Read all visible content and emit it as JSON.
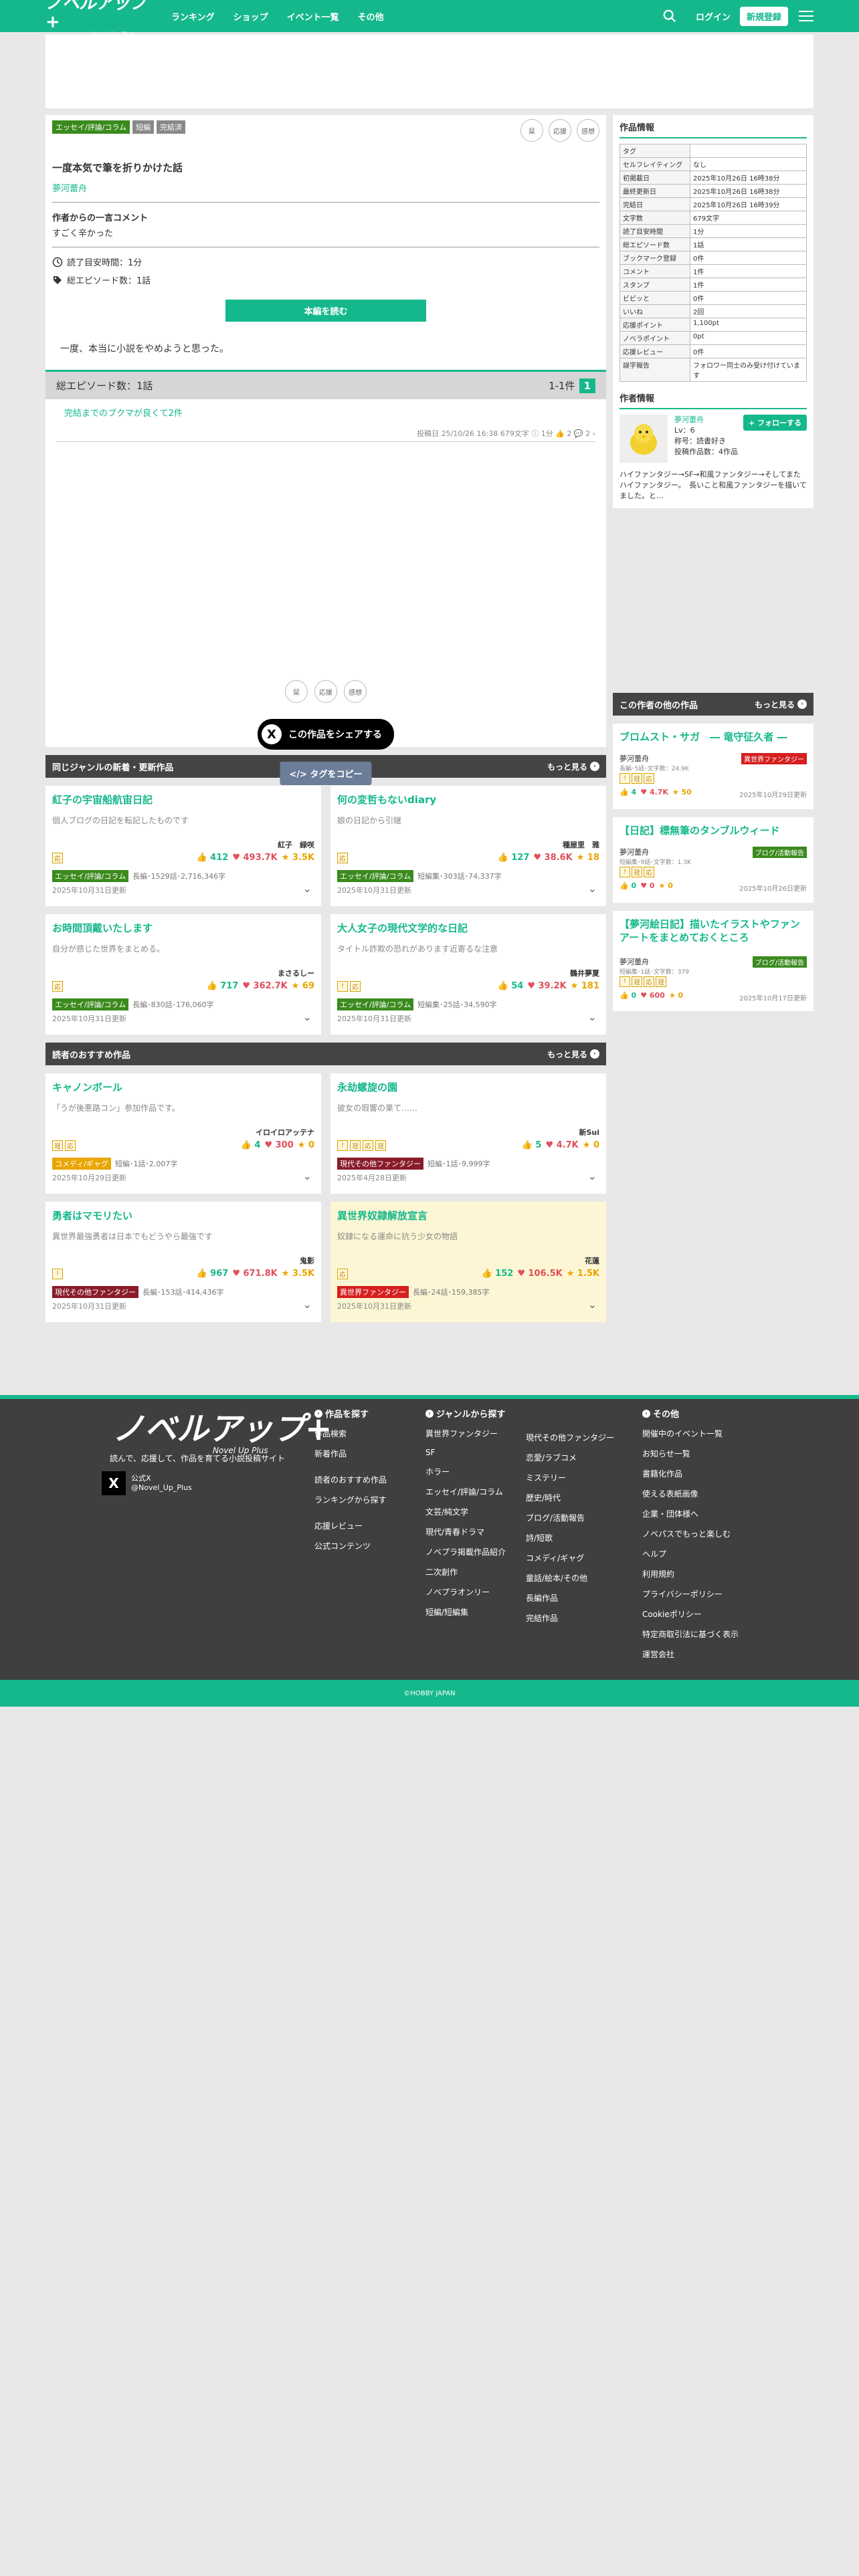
{
  "header": {
    "logo": "ノベルアップ+",
    "logo_sub": "Novel Up Plus",
    "nav": [
      "ランキング",
      "ショップ",
      "イベント一覧",
      "その他"
    ],
    "login": "ログイン",
    "signup": "新規登録"
  },
  "work": {
    "tags": [
      "エッセイ/評論/コラム",
      "短編",
      "完結済"
    ],
    "icons": [
      "栞",
      "応援",
      "感想"
    ],
    "title": "一度本気で筆を折りかけた話",
    "author": "夢河蕾舟",
    "comment_heading": "作者からの一言コメント",
    "comment": "すごく辛かった",
    "read_time": "読了目安時間：1分",
    "episode_count": "総エピソード数：1話",
    "read_button": "本編を読む",
    "synopsis": "一度、本当に小説をやめようと思った。"
  },
  "episodes": {
    "total": "総エピソード数：1話",
    "range": "1-1件",
    "page": "1",
    "items": [
      {
        "title": "完結までのブクマが良くて2件",
        "meta": "投稿日 25/10/26 16:38  679文字  ⓘ 1分  👍 2  💬 2  ›"
      }
    ],
    "share": "この作品をシェアする",
    "share_icon": "X",
    "copy_tag": "</>  タグをコピー"
  },
  "same_genre": {
    "heading": "同じジャンルの新着・更新作品",
    "more": "もっと見る",
    "cards": [
      {
        "title": "紅子の宇宙船航宙日記",
        "desc": "個人ブログの日記を転記したものです",
        "author": "紅子　緑咲",
        "icons": [
          "応"
        ],
        "likes": "412",
        "hearts": "493.7K",
        "stars": "3.5K",
        "tag": "エッセイ/評論/コラム",
        "tag_color": "green",
        "info": "長編･1529話･2,716,346字",
        "date": "2025年10月31日更新",
        "yellow": false
      },
      {
        "title": "何の変哲もないdiary",
        "desc": "娘の日記から引継",
        "author": "種屋里　雅",
        "icons": [
          "応"
        ],
        "likes": "127",
        "hearts": "38.6K",
        "stars": "18",
        "tag": "エッセイ/評論/コラム",
        "tag_color": "green",
        "info": "短編集･303話･74,337字",
        "date": "2025年10月31日更新",
        "yellow": false
      },
      {
        "title": "お時間頂戴いたします",
        "desc": "自分が感じた世界をまとめる。",
        "author": "まさるしー",
        "icons": [
          "応"
        ],
        "likes": "717",
        "hearts": "362.7K",
        "stars": "69",
        "tag": "エッセイ/評論/コラム",
        "tag_color": "green",
        "info": "長編･830話･176,060字",
        "date": "2025年10月31日更新",
        "yellow": false
      },
      {
        "title": "大人女子の現代文学的な日記",
        "desc": "タイトル詐欺の恐れがあります近寄るな注意",
        "author": "鶴井夢夏",
        "icons": [
          "!",
          "応"
        ],
        "likes": "54",
        "hearts": "39.2K",
        "stars": "181",
        "tag": "エッセイ/評論/コラム",
        "tag_color": "green",
        "info": "短編集･25話･34,590字",
        "date": "2025年10月31日更新",
        "yellow": false
      }
    ]
  },
  "recommended": {
    "heading": "読者のおすすめ作品",
    "more": "もっと見る",
    "cards": [
      {
        "title": "キャノンボール",
        "desc": "「うが後悪路コン」参加作品です。",
        "author": "イロイロアッテナ",
        "icons": [
          "冠",
          "応"
        ],
        "likes": "4",
        "hearts": "300",
        "stars": "0",
        "tag": "コメディ/ギャグ",
        "tag_color": "orange",
        "info": "短編･1話･2,007字",
        "date": "2025年10月29日更新",
        "yellow": false
      },
      {
        "title": "永劫螺旋の園",
        "desc": "彼女の瑕響の果て……",
        "author": "新Sui",
        "icons": [
          "!",
          "冠",
          "応",
          "冠"
        ],
        "likes": "5",
        "hearts": "4.7K",
        "stars": "0",
        "tag": "現代その他ファンタジー",
        "tag_color": "maroon",
        "info": "短編･1話･9,999字",
        "date": "2025年4月28日更新",
        "yellow": false
      },
      {
        "title": "勇者はマモリたい",
        "desc": "異世界最強勇者は日本でもどうやら最強です",
        "author": "鬼影",
        "icons": [
          "!"
        ],
        "likes": "967",
        "hearts": "671.8K",
        "stars": "3.5K",
        "tag": "現代その他ファンタジー",
        "tag_color": "maroon",
        "info": "長編･153話･414,436字",
        "date": "2025年10月31日更新",
        "yellow": false
      },
      {
        "title": "異世界奴隷解放宣言",
        "desc": "奴隷になる運命に抗う少女の物語",
        "author": "花蓮",
        "icons": [
          "応"
        ],
        "likes": "152",
        "hearts": "106.5K",
        "stars": "1.5K",
        "tag": "異世界ファンタジー",
        "tag_color": "red",
        "info": "長編･24話･159,385字",
        "date": "2025年10月31日更新",
        "yellow": true
      }
    ]
  },
  "work_info": {
    "heading": "作品情報",
    "rows": [
      [
        "タグ",
        ""
      ],
      [
        "セルフレイティング",
        "なし"
      ],
      [
        "初掲載日",
        "2025年10月26日 16時38分"
      ],
      [
        "最終更新日",
        "2025年10月26日 16時38分"
      ],
      [
        "完結日",
        "2025年10月26日 16時39分"
      ],
      [
        "文字数",
        "679文字"
      ],
      [
        "読了目安時間",
        "1分"
      ],
      [
        "総エピソード数",
        "1話"
      ],
      [
        "ブックマーク登録",
        "0件"
      ],
      [
        "コメント",
        "1件"
      ],
      [
        "スタンプ",
        "1件"
      ],
      [
        "ビビッと",
        "0件"
      ],
      [
        "いいね",
        "2回"
      ],
      [
        "応援ポイント",
        "1,100pt"
      ],
      [
        "ノベラポイント",
        "0pt"
      ],
      [
        "応援レビュー",
        "0件"
      ],
      [
        "誤字報告",
        "フォロワー同士のみ受け付けています"
      ]
    ]
  },
  "author_info": {
    "heading": "作者情報",
    "name": "夢河蕾舟",
    "level": "Lv：6",
    "title": "称号：読書好き",
    "posts": "投稿作品数：4作品",
    "follow": "+ フォローする",
    "bio": "ハイファンタジー→SF→和風ファンタジー→そしてまたハイファンタジー。　長いこと和風ファンタジーを描いてました。と…"
  },
  "other_works": {
    "heading": "この作者の他の作品",
    "more": "もっと見る",
    "cards": [
      {
        "title": "ブロムスト・サガ　― 竜守征久者 ―",
        "author": "夢河蕾舟",
        "badge": "異世界ファンタジー",
        "badge_color": "#d62020",
        "sub": "長編･5話･文字数：24.9K",
        "icons": [
          "!",
          "冠",
          "応"
        ],
        "likes": "4",
        "hearts": "4.7K",
        "stars": "50",
        "date": "2025年10月29日更新"
      },
      {
        "title": "【日記】標無筆のタンブルウィード",
        "author": "夢河蕾舟",
        "badge": "ブログ/活動報告",
        "badge_color": "#3b8a1e",
        "sub": "短編集･9話･文字数：1.3K",
        "icons": [
          "!",
          "冠",
          "応"
        ],
        "likes": "0",
        "hearts": "0",
        "stars": "0",
        "date": "2025年10月26日更新"
      },
      {
        "title": "【夢河絵日記】描いたイラストやファンアートをまとめておくところ",
        "author": "夢河蕾舟",
        "badge": "ブログ/活動報告",
        "badge_color": "#3b8a1e",
        "sub": "短編集･1話･文字数：379",
        "icons": [
          "!",
          "冠",
          "応",
          "冠"
        ],
        "likes": "0",
        "hearts": "600",
        "stars": "0",
        "date": "2025年10月17日更新"
      }
    ]
  },
  "footer": {
    "logo": "ノベルアップ+",
    "logo_sub": "Novel Up Plus",
    "tagline": "読んで、応援して、作品を育てる小説投稿サイト",
    "x_label": "公式X",
    "x_handle": "@Novel_Up_Plus",
    "col1_h": "作品を探す",
    "col1": [
      "作品検索",
      "新着作品",
      "読者のおすすめ作品",
      "ランキングから探す",
      "応援レビュー",
      "公式コンテンツ"
    ],
    "col2_h": "ジャンルから探す",
    "col2a": [
      "異世界ファンタジー",
      "SF",
      "ホラー",
      "エッセイ/評論/コラム",
      "文芸/純文学",
      "現代/青春ドラマ",
      "ノベプラ掲載作品紹介",
      "二次創作",
      "ノベプラオンリー",
      "短編/短編集"
    ],
    "col2b": [
      "現代その他ファンタジー",
      "恋愛/ラブコメ",
      "ミステリー",
      "歴史/時代",
      "ブログ/活動報告",
      "詩/短歌",
      "コメディ/ギャグ",
      "童話/絵本/その他",
      "長編作品",
      "完結作品"
    ],
    "col3_h": "その他",
    "col3": [
      "開催中のイベント一覧",
      "お知らせ一覧",
      "書籍化作品",
      "使える表紙画像",
      "企業・団体様へ",
      "ノベパスでもっと楽しむ",
      "ヘルプ",
      "利用規約",
      "プライバシーポリシー",
      "Cookieポリシー",
      "特定商取引法に基づく表示",
      "運営会社"
    ],
    "copyright": "©HOBBY JAPAN"
  },
  "colors": {
    "accent": "#15b88c",
    "dark": "#444444",
    "heart": "#e0505a",
    "star": "#e9a500"
  }
}
